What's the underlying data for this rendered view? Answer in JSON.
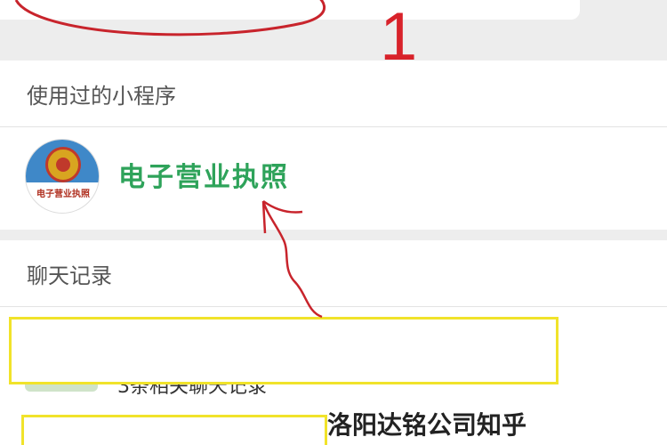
{
  "sections": {
    "mini_programs": {
      "header": "使用过的小程序",
      "items": [
        {
          "name": "电子营业执照",
          "logo_label": "电子营业执照",
          "icon": "national-emblem-icon"
        }
      ]
    },
    "chat_records": {
      "header": "聊天记录",
      "rows": [
        {
          "text": "3条相关聊天记录"
        },
        {
          "text": "洛阳达铭公司知乎"
        }
      ]
    }
  },
  "annotation": {
    "number": "1",
    "color": "#d8222a",
    "highlight_color": "#f1e32a"
  },
  "colors": {
    "mini_program_name": "#2ea35a",
    "background": "#ededed"
  }
}
